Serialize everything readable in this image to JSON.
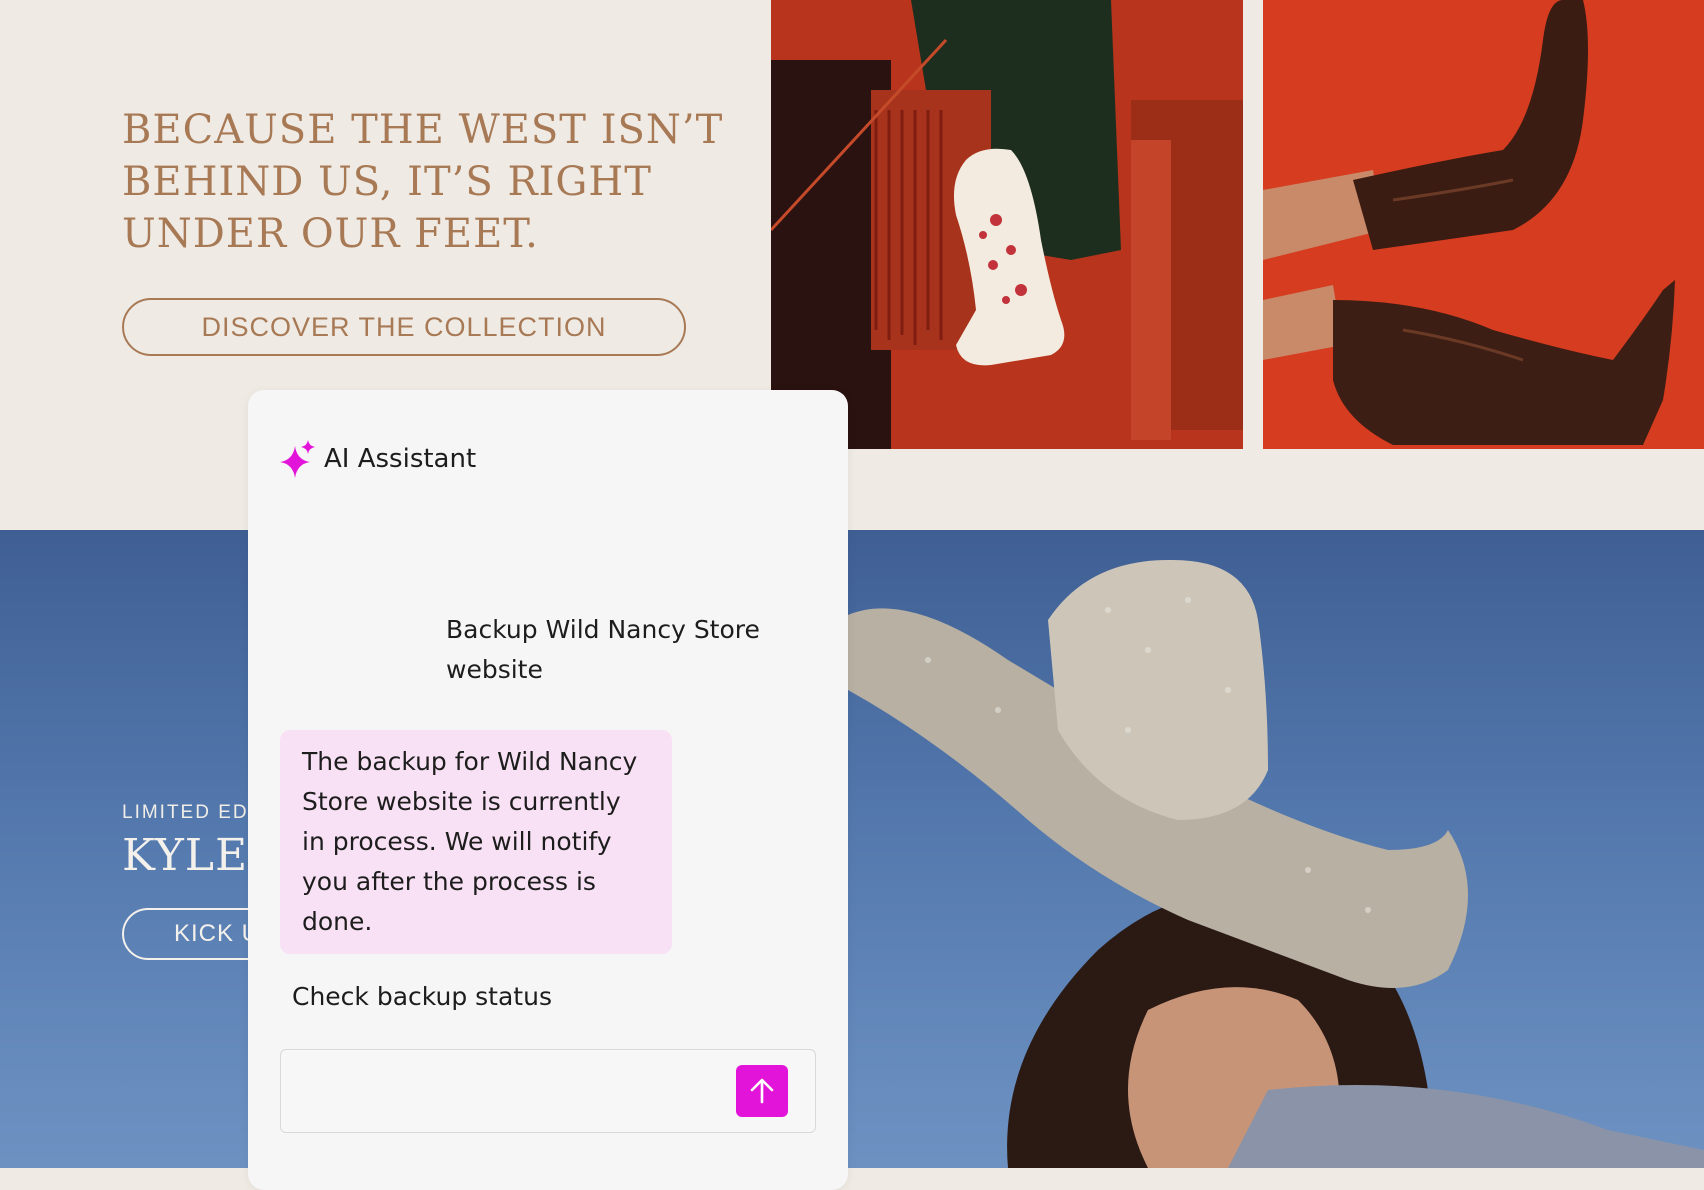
{
  "hero": {
    "headline": "BECAUSE THE WEST ISN’T BEHIND US, IT’S RIGHT UNDER OUR FEET.",
    "cta_label": "DISCOVER THE COLLECTION"
  },
  "feature": {
    "eyebrow": "LIMITED EDI",
    "title": "KYLE",
    "cta_label": "KICK U"
  },
  "assistant": {
    "title": "AI Assistant",
    "icon": "sparkle-icon",
    "accent_color": "#e314d9",
    "bubble_color": "#f8e1f4",
    "messages": [
      {
        "role": "user",
        "text": "Backup Wild Nancy Store website"
      },
      {
        "role": "assistant",
        "text": "The backup for Wild Nancy Store website is currently in process. We will notify you after the process is done."
      }
    ],
    "suggestion": "Check backup status",
    "input": {
      "value": "",
      "placeholder": ""
    },
    "send_icon": "arrow-up-icon"
  }
}
